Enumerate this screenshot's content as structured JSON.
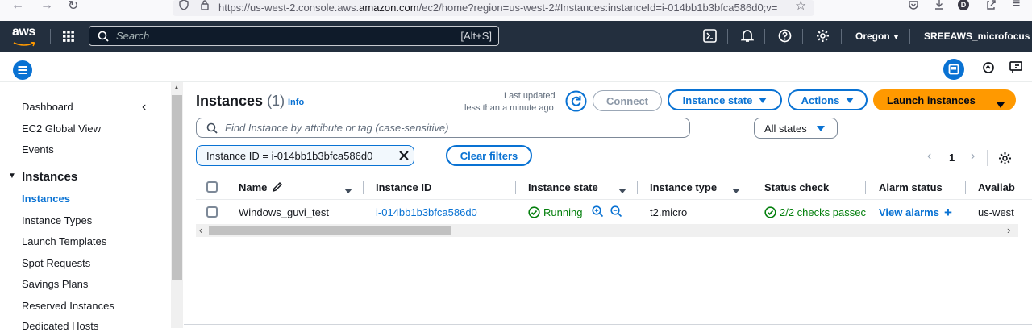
{
  "browser": {
    "url_prefix": "https://us-west-2.console.aws.",
    "url_domain": "amazon.com",
    "url_suffix": "/ec2/home?region=us-west-2#Instances:instanceId=i-014bb1b3bfca586d0;v=",
    "profile_initial": "D"
  },
  "topnav": {
    "logo": "aws",
    "search_placeholder": "Search",
    "search_shortcut": "[Alt+S]",
    "region": "Oregon",
    "account": "SREEAWS_microfocus"
  },
  "sidebar": {
    "items": [
      {
        "label": "Dashboard"
      },
      {
        "label": "EC2 Global View"
      },
      {
        "label": "Events"
      }
    ],
    "section": "Instances",
    "sub_items": [
      {
        "label": "Instances"
      },
      {
        "label": "Instance Types"
      },
      {
        "label": "Launch Templates"
      },
      {
        "label": "Spot Requests"
      },
      {
        "label": "Savings Plans"
      },
      {
        "label": "Reserved Instances"
      },
      {
        "label": "Dedicated Hosts"
      }
    ]
  },
  "main": {
    "title": "Instances",
    "count": "(1)",
    "info": "Info",
    "last_updated_label": "Last updated",
    "last_updated_value": "less than a minute ago",
    "connect": "Connect",
    "instance_state": "Instance state",
    "actions": "Actions",
    "launch": "Launch instances",
    "find_placeholder": "Find Instance by attribute or tag (case-sensitive)",
    "states_filter": "All states",
    "filter_token": "Instance ID = i-014bb1b3bfca586d0",
    "clear_filters": "Clear filters",
    "page": "1"
  },
  "table": {
    "headers": [
      "Name",
      "Instance ID",
      "Instance state",
      "Instance type",
      "Status check",
      "Alarm status",
      "Availab"
    ],
    "row": {
      "name": "Windows_guvi_test",
      "instance_id": "i-014bb1b3bfca586d0",
      "state": "Running",
      "type": "t2.micro",
      "status_check": "2/2 checks passec",
      "alarm": "View alarms",
      "availability": "us-west"
    }
  },
  "colors": {
    "link": "#0972d3",
    "success": "#037f0c",
    "primary": "#ff9900",
    "nav_bg": "#232f3e"
  }
}
